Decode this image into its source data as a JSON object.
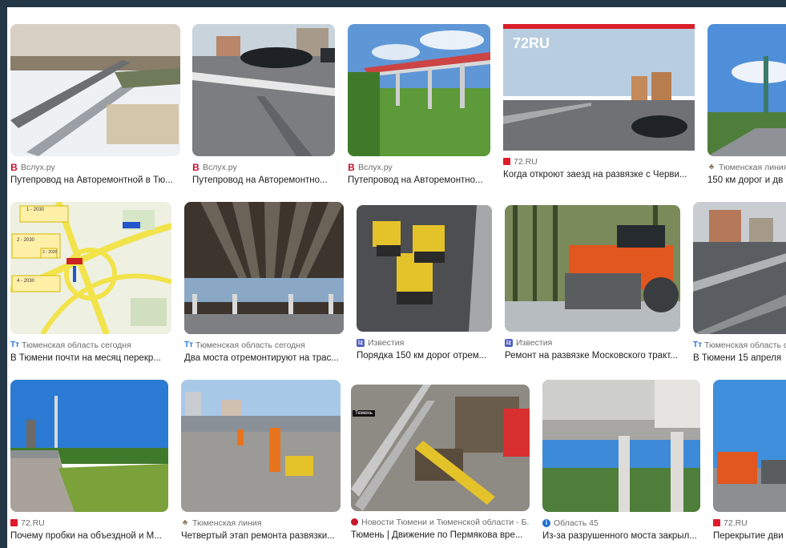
{
  "results": [
    {
      "source": "Вслух.ру",
      "source_icon": "vsluh-logo-icon",
      "title": "Путепровод на Авторемонтной в Тю..."
    },
    {
      "source": "Вслух.ру",
      "source_icon": "vsluh-logo-icon",
      "title": "Путепровод на Авторемонтно..."
    },
    {
      "source": "Вслух.ру",
      "source_icon": "vsluh-logo-icon",
      "title": "Путепровод на Авторемонтно..."
    },
    {
      "source": "72.RU",
      "source_icon": "72ru-logo-icon",
      "title": "Когда откроют заезд на развязке с Черви...",
      "thumb_logo": "72RU"
    },
    {
      "source": "Тюменская линия",
      "source_icon": "tyumen-line-logo-icon",
      "title": "150 км дорог и дв"
    },
    {
      "source": "Тюменская область сегодня",
      "source_icon": "tos-logo-icon",
      "title": "В Тюмени почти на месяц перекр...",
      "map_labels": [
        "1 - 2030",
        "2 - 2030",
        "3 - 2030",
        "4 - 2030"
      ]
    },
    {
      "source": "Тюменская область сегодня",
      "source_icon": "tos-logo-icon",
      "title": "Два моста отремонтируют на трас..."
    },
    {
      "source": "Известия",
      "source_icon": "izvestia-logo-icon",
      "title": "Порядка 150 км дорог отрем..."
    },
    {
      "source": "Известия",
      "source_icon": "izvestia-logo-icon",
      "title": "Ремонт на развязке Московского тракт..."
    },
    {
      "source": "Тюменская область с",
      "source_icon": "tos-logo-icon",
      "title": "В Тюмени 15 апреля"
    },
    {
      "source": "72.RU",
      "source_icon": "72ru-logo-icon",
      "title": "Почему пробки на объездной и М..."
    },
    {
      "source": "Тюменская линия",
      "source_icon": "tyumen-line-logo-icon",
      "title": "Четвертый этап ремонта развязки..."
    },
    {
      "source": "Новости Тюмени и Тюменской области - Б...",
      "source_icon": "news-tyumen-logo-icon",
      "title": "Тюмень | Движение по Пермякова вре...",
      "thumb_tag": "Тюмень"
    },
    {
      "source": "Область 45",
      "source_icon": "oblast45-logo-icon",
      "title": "Из-за разрушенного моста закрыл..."
    },
    {
      "source": "72.RU",
      "source_icon": "72ru-logo-icon",
      "title": "Перекрытие дви"
    }
  ]
}
